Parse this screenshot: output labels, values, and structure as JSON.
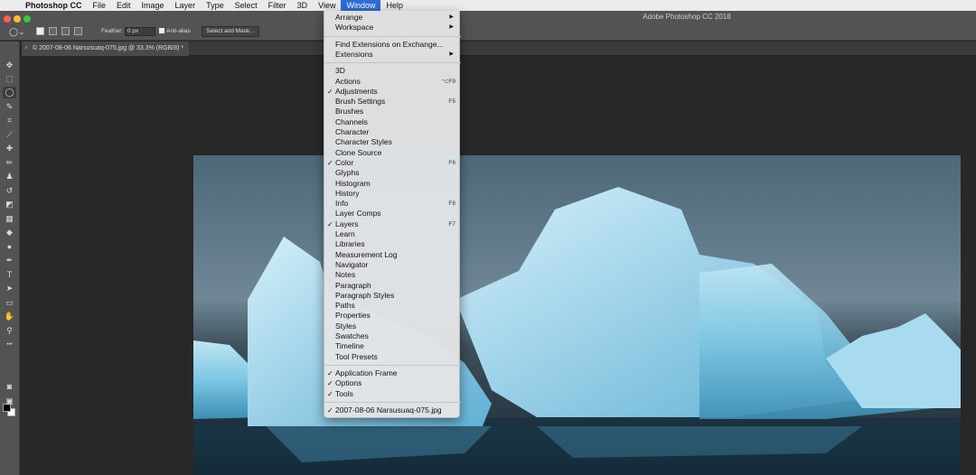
{
  "menubar": {
    "apple": "",
    "app": "Photoshop CC",
    "items": [
      "File",
      "Edit",
      "Image",
      "Layer",
      "Type",
      "Select",
      "Filter",
      "3D",
      "View",
      "Window",
      "Help"
    ],
    "active": "Window"
  },
  "app_title": "Adobe Photoshop CC 2018",
  "options": {
    "feather_label": "Feather:",
    "feather_value": "0 px",
    "anti_alias_label": "Anti-alias",
    "select_mask_label": "Select and Mask..."
  },
  "document_tab": {
    "close": "×",
    "title": "© 2007-08-06 Narsusuaq-075.jpg @ 33.3% (RGB/8) *"
  },
  "toolbar": {
    "tools": [
      {
        "name": "move-tool-icon",
        "glyph": "✥"
      },
      {
        "name": "marquee-tool-icon",
        "glyph": "⬚"
      },
      {
        "name": "lasso-tool-icon",
        "glyph": "◯",
        "selected": true
      },
      {
        "name": "quick-selection-tool-icon",
        "glyph": "✎"
      },
      {
        "name": "crop-tool-icon",
        "glyph": "⌗"
      },
      {
        "name": "eyedropper-tool-icon",
        "glyph": "⟋"
      },
      {
        "name": "healing-brush-tool-icon",
        "glyph": "✚"
      },
      {
        "name": "brush-tool-icon",
        "glyph": "✏"
      },
      {
        "name": "clone-stamp-tool-icon",
        "glyph": "♟"
      },
      {
        "name": "history-brush-tool-icon",
        "glyph": "↺"
      },
      {
        "name": "eraser-tool-icon",
        "glyph": "◩"
      },
      {
        "name": "gradient-tool-icon",
        "glyph": "▦"
      },
      {
        "name": "blur-tool-icon",
        "glyph": "◆"
      },
      {
        "name": "dodge-tool-icon",
        "glyph": "●"
      },
      {
        "name": "pen-tool-icon",
        "glyph": "✒"
      },
      {
        "name": "type-tool-icon",
        "glyph": "T"
      },
      {
        "name": "path-selection-tool-icon",
        "glyph": "➤"
      },
      {
        "name": "rectangle-tool-icon",
        "glyph": "▭"
      },
      {
        "name": "hand-tool-icon",
        "glyph": "✋"
      },
      {
        "name": "zoom-tool-icon",
        "glyph": "⚲"
      },
      {
        "name": "more-tools-icon",
        "glyph": "•••"
      }
    ],
    "extra": [
      {
        "name": "quick-mask-icon",
        "glyph": "◙"
      },
      {
        "name": "screen-mode-icon",
        "glyph": "▣"
      }
    ]
  },
  "window_menu": {
    "items": [
      {
        "label": "Arrange",
        "submenu": true
      },
      {
        "label": "Workspace",
        "submenu": true
      },
      {
        "sep": true
      },
      {
        "label": "Find Extensions on Exchange..."
      },
      {
        "label": "Extensions",
        "submenu": true
      },
      {
        "sep": true
      },
      {
        "label": "3D"
      },
      {
        "label": "Actions",
        "shortcut": "⌥F9"
      },
      {
        "label": "Adjustments",
        "checked": true
      },
      {
        "label": "Brush Settings",
        "shortcut": "F5"
      },
      {
        "label": "Brushes"
      },
      {
        "label": "Channels"
      },
      {
        "label": "Character"
      },
      {
        "label": "Character Styles"
      },
      {
        "label": "Clone Source"
      },
      {
        "label": "Color",
        "checked": true,
        "shortcut": "F6"
      },
      {
        "label": "Glyphs"
      },
      {
        "label": "Histogram"
      },
      {
        "label": "History"
      },
      {
        "label": "Info",
        "shortcut": "F8"
      },
      {
        "label": "Layer Comps"
      },
      {
        "label": "Layers",
        "checked": true,
        "shortcut": "F7"
      },
      {
        "label": "Learn"
      },
      {
        "label": "Libraries"
      },
      {
        "label": "Measurement Log"
      },
      {
        "label": "Navigator"
      },
      {
        "label": "Notes"
      },
      {
        "label": "Paragraph"
      },
      {
        "label": "Paragraph Styles"
      },
      {
        "label": "Paths"
      },
      {
        "label": "Properties"
      },
      {
        "label": "Styles"
      },
      {
        "label": "Swatches"
      },
      {
        "label": "Timeline"
      },
      {
        "label": "Tool Presets"
      },
      {
        "sep": true
      },
      {
        "label": "Application Frame",
        "checked": true
      },
      {
        "label": "Options",
        "checked": true
      },
      {
        "label": "Tools",
        "checked": true
      },
      {
        "sep": true
      },
      {
        "label": "2007-08-06 Narsusuaq-075.jpg",
        "checked": true
      }
    ]
  },
  "colors": {
    "menubar_bg": "#ebebeb",
    "menu_highlight": "#2f6bd6",
    "panel_bg": "#535353",
    "canvas_bg": "#282828",
    "close_button": "#fc5f57",
    "minimize_button": "#fdbc2e",
    "zoom_button": "#34c84a"
  }
}
